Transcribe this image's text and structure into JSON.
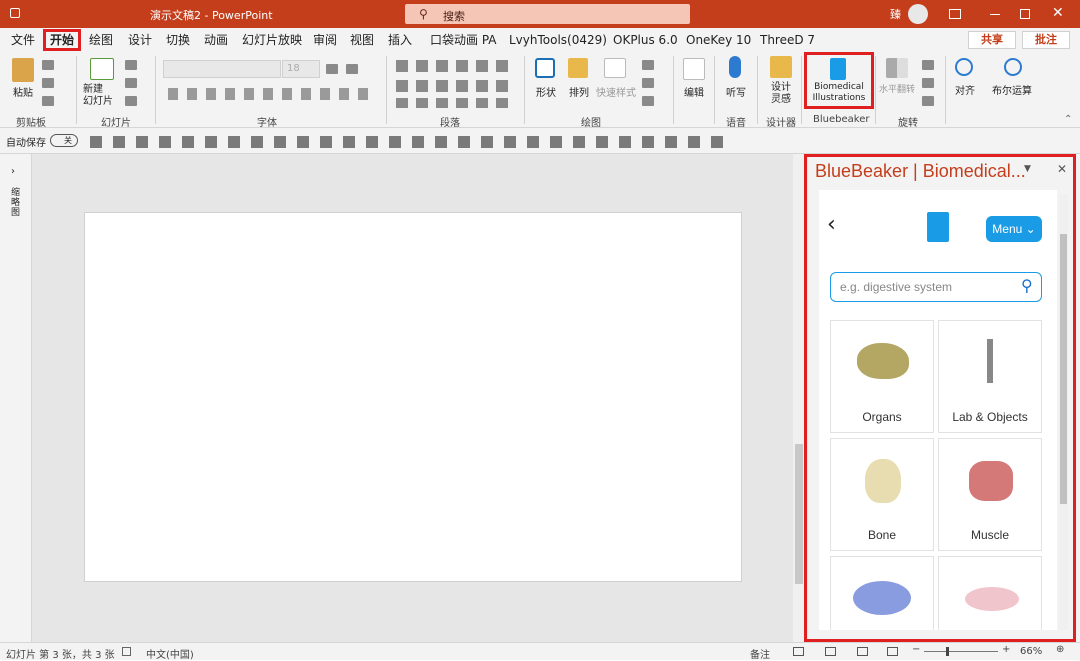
{
  "window": {
    "title": "演示文稿2 - PowerPoint",
    "search": "搜索",
    "user_initial": "臻"
  },
  "tabs": [
    "文件",
    "开始",
    "绘图",
    "设计",
    "切换",
    "动画",
    "幻灯片放映",
    "审阅",
    "视图",
    "插入",
    "口袋动画 PA",
    "LvyhTools(0429)",
    "OKPlus 6.0",
    "OneKey 10",
    "ThreeD 7"
  ],
  "share": "共享",
  "comment": "批注",
  "ribbon": {
    "paste": "粘贴",
    "new_slide": "新建\n幻灯片",
    "font_size": "18",
    "shape": "形状",
    "arrange": "排列",
    "quick_style": "快速样式",
    "edit": "编辑",
    "dictate": "听写",
    "design_idea": "设计\n灵感",
    "bio_button": "Biomedical\nIllustrations",
    "flip": "水平翻转",
    "align": "对齐",
    "boolean": "布尔运算",
    "groups": [
      "剪贴板",
      "幻灯片",
      "字体",
      "段落",
      "绘图",
      "语音",
      "设计器",
      "Bluebeaker",
      "旋转"
    ]
  },
  "qat": {
    "autosave": "自动保存",
    "autosave_state": "关"
  },
  "thumbs_label": "缩略图",
  "panel": {
    "title": "BlueBeaker | Biomedical...",
    "menu": "Menu",
    "search_placeholder": "e.g. digestive system",
    "categories": [
      "Organs",
      "Lab & Objects",
      "Bone",
      "Muscle"
    ]
  },
  "status": {
    "slide": "幻灯片 第 3 张，共 3 张",
    "lang": "中文(中国)",
    "notes": "备注",
    "zoom": "66%"
  },
  "colors": {
    "accent": "#c43e1c",
    "panel_blue": "#1a9be6",
    "highlight": "#e02020"
  }
}
